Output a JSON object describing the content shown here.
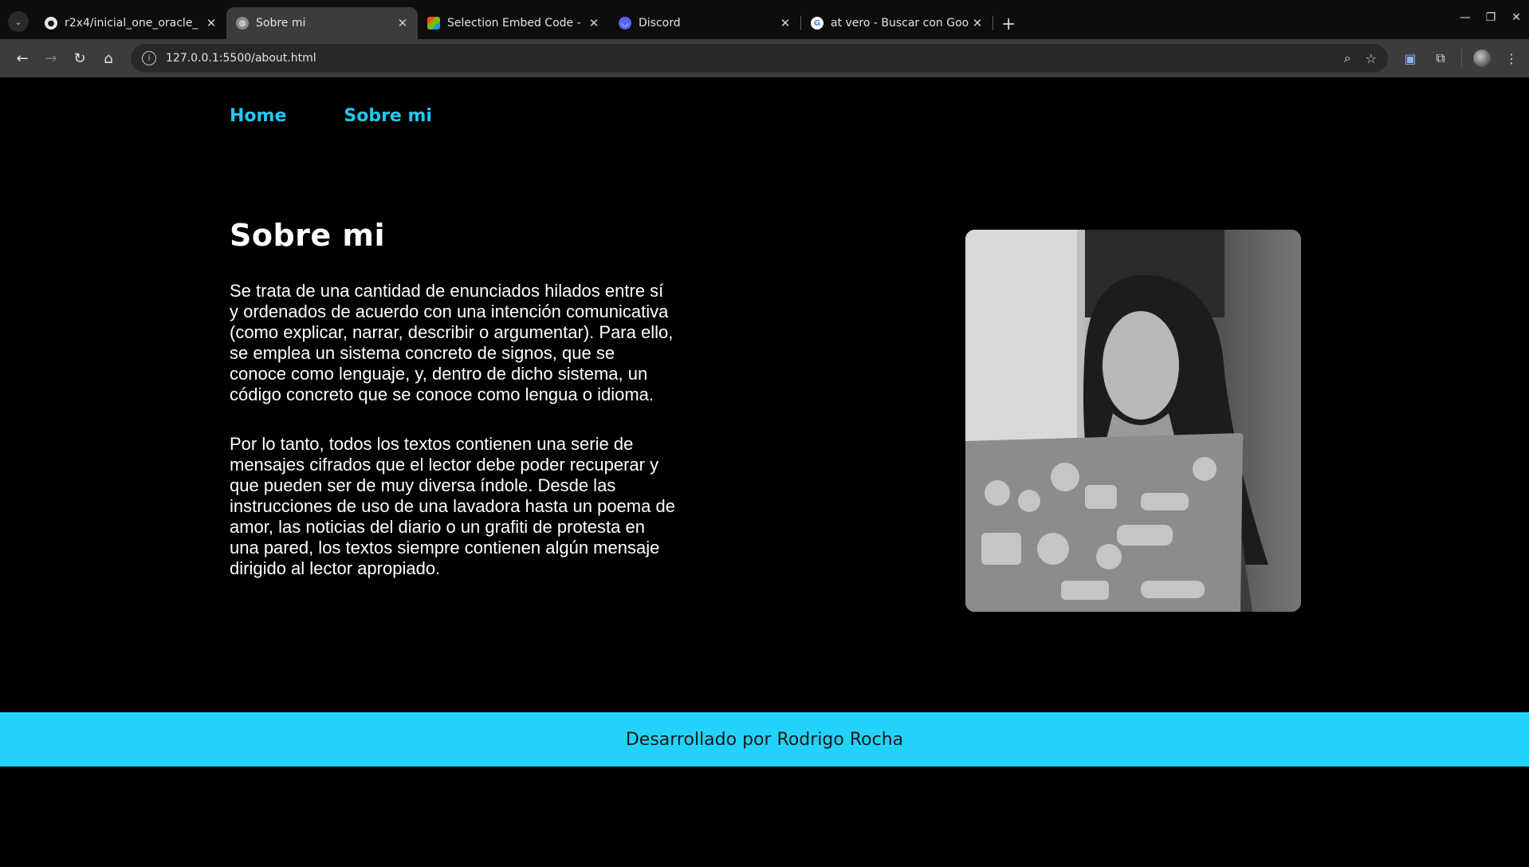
{
  "browser": {
    "tabs": [
      {
        "title": "r2x4/inicial_one_oracle_",
        "favicon": "github-icon",
        "active": false
      },
      {
        "title": "Sobre mi",
        "favicon": "globe-icon",
        "active": true
      },
      {
        "title": "Selection Embed Code - ",
        "favicon": "embed-logo-icon",
        "active": false
      },
      {
        "title": "Discord",
        "favicon": "discord-icon",
        "active": false
      },
      {
        "title": "at vero - Buscar con Goo",
        "favicon": "google-icon",
        "active": false
      }
    ],
    "url": "127.0.0.1:5500/about.html"
  },
  "nav": {
    "home": "Home",
    "about": "Sobre mi"
  },
  "about": {
    "title": "Sobre mi",
    "paragraph1": "Se trata de una cantidad de enunciados hilados entre sí y ordenados de acuerdo con una intención comunicativa (como explicar, narrar, describir o argumentar). Para ello, se emplea un sistema concreto de signos, que se conoce como lenguaje, y, dentro de dicho sistema, un código concreto que se conoce como lengua o idioma.",
    "paragraph2": "Por lo tanto, todos los textos contienen una serie de mensajes cifrados que el lector debe poder recuperar y que pueden ser de muy diversa índole. Desde las instrucciones de uso de una lavadora hasta un poema de amor, las noticias del diario o un grafiti de protesta en una pared, los textos siempre contienen algún mensaje dirigido al lector apropiado."
  },
  "footer": {
    "text": "Desarrollado por Rodrigo Rocha"
  },
  "colors": {
    "accent": "#22c7f0",
    "footer_bg": "#22d2fb",
    "page_bg": "#000000"
  }
}
